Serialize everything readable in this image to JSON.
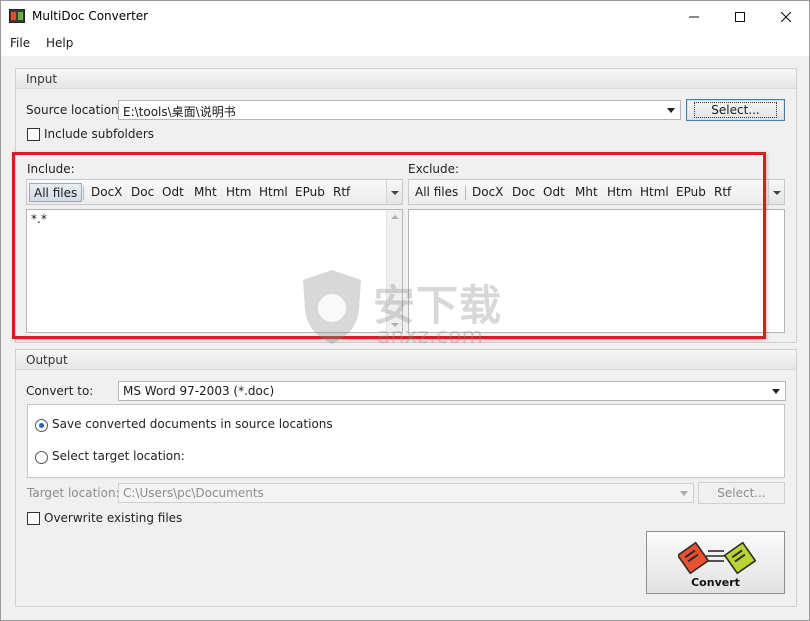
{
  "window": {
    "title": "MultiDoc Converter"
  },
  "menu": {
    "file": "File",
    "help": "Help"
  },
  "input": {
    "group_title": "Input",
    "source_label": "Source location:",
    "source_value": "E:\\tools\\桌面\\说明书",
    "select_button": "Select...",
    "include_subfolders": "Include subfolders",
    "include_subfolders_checked": false,
    "include_label": "Include:",
    "exclude_label": "Exclude:",
    "filter_tabs": [
      "All files",
      "DocX",
      "Doc",
      "Odt",
      "Mht",
      "Htm",
      "Html",
      "EPub",
      "Rtf"
    ],
    "include_active_tab": "All files",
    "include_text": "*.*",
    "exclude_text": ""
  },
  "output": {
    "group_title": "Output",
    "convert_to_label": "Convert to:",
    "convert_to_value": "MS Word 97-2003 (*.doc)",
    "radio_source": "Save converted documents in source locations",
    "radio_target": "Select target location:",
    "selected_option": "source",
    "target_label": "Target location:",
    "target_value": "C:\\Users\\pc\\Documents",
    "target_select_button": "Select...",
    "overwrite": "Overwrite existing files",
    "overwrite_checked": false,
    "convert_button": "Convert"
  },
  "watermark": {
    "text": "安下载",
    "sub": "anxz.com"
  },
  "colors": {
    "highlight_border": "#d01f25",
    "radio_dot": "#2666b0",
    "focus_border": "#3c7fb1"
  }
}
